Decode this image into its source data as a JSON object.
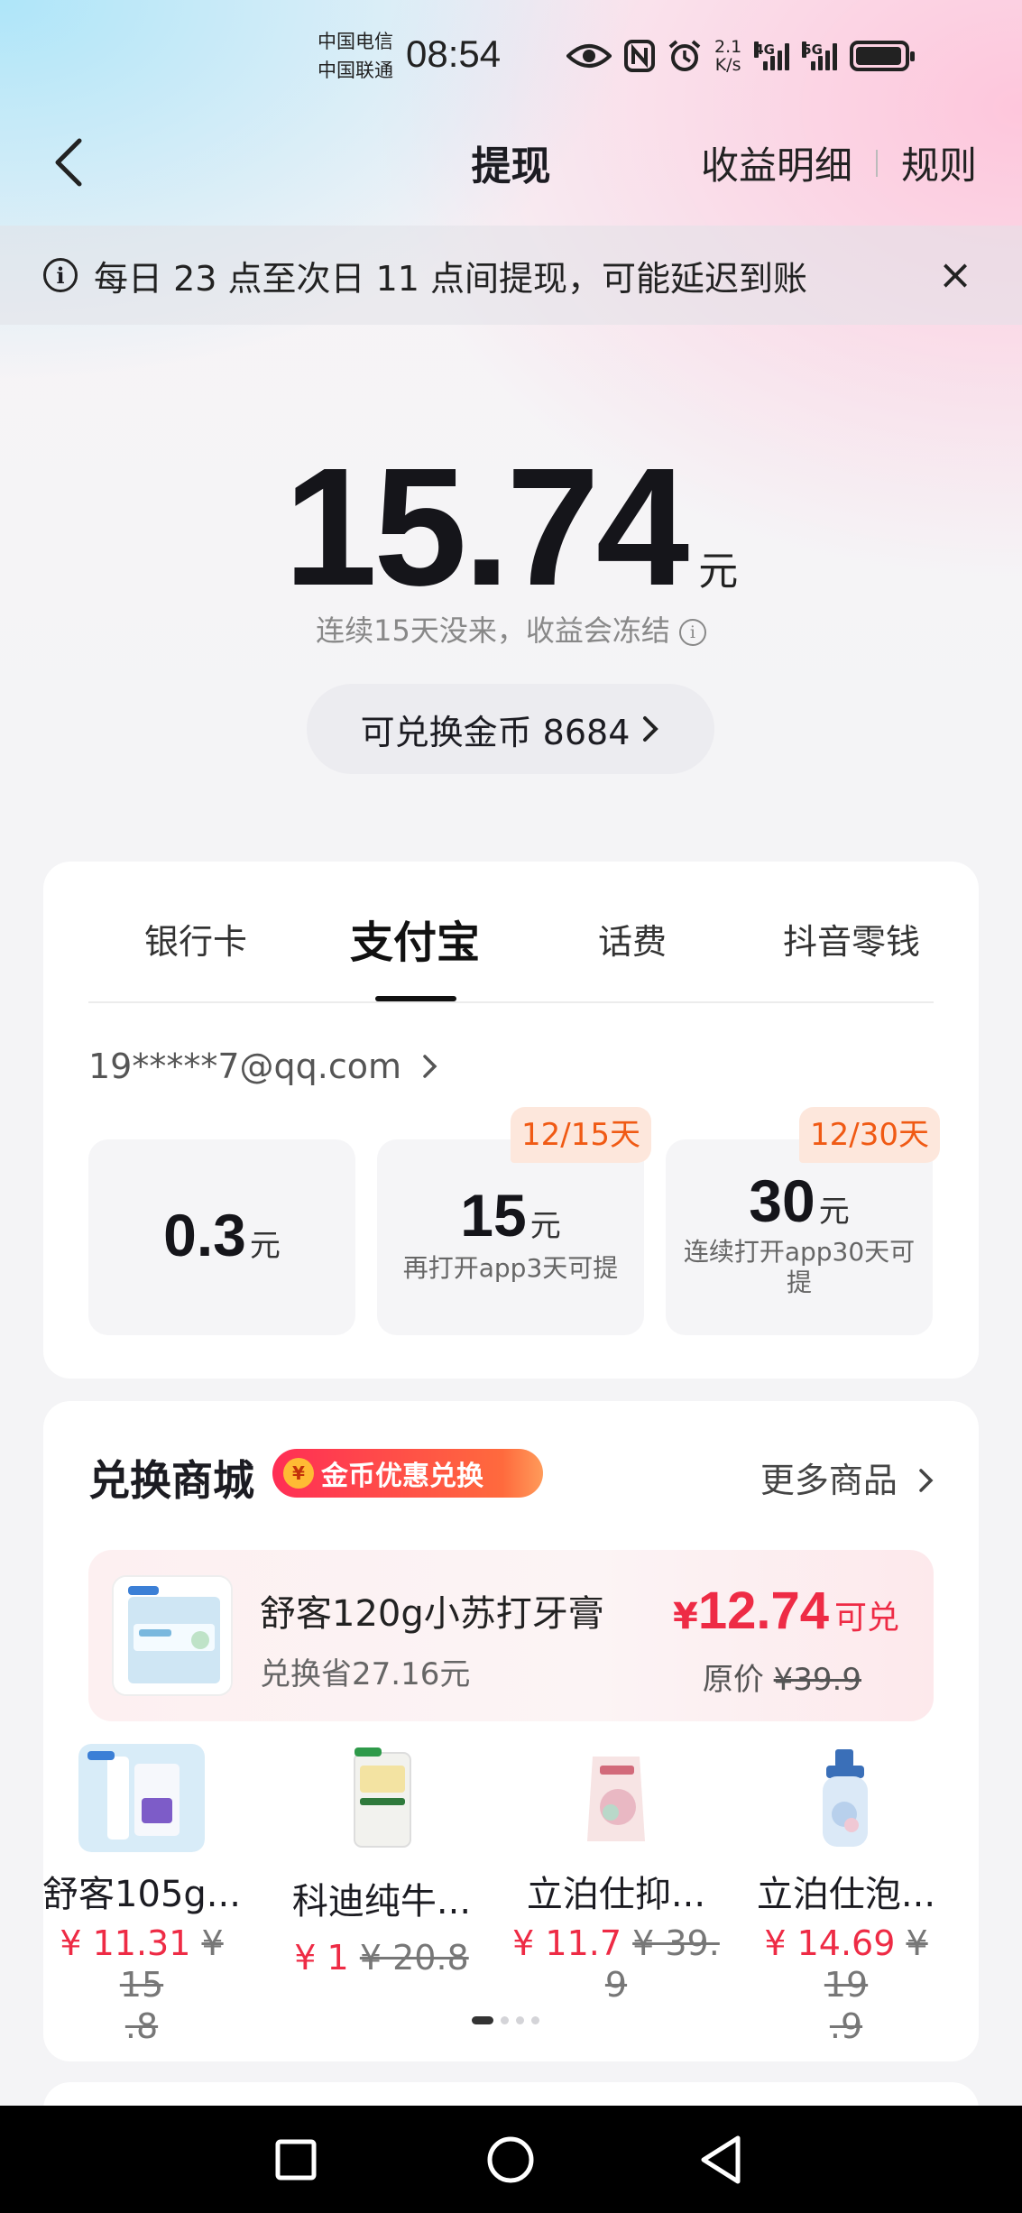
{
  "status_bar": {
    "carrier_1": "中国电信",
    "carrier_2": "中国联通",
    "time": "08:54",
    "net_speed_value": "2.1",
    "net_speed_unit": "K/s",
    "signal_1_label": "4G",
    "signal_2_label": "5G",
    "icons": [
      "eye-icon",
      "nfc-icon",
      "alarm-icon",
      "signal-icon",
      "battery-icon"
    ]
  },
  "nav": {
    "title": "提现",
    "earnings_detail": "收益明细",
    "rules": "规则"
  },
  "notice": {
    "text": "每日 23 点至次日 11 点间提现，可能延迟到账"
  },
  "balance": {
    "amount": "15.74",
    "unit": "元",
    "freeze_note": "连续15天没来，收益会冻结",
    "coins_label": "可兑换金币 8684"
  },
  "withdraw": {
    "tabs": [
      {
        "label": "银行卡"
      },
      {
        "label": "支付宝"
      },
      {
        "label": "话费"
      },
      {
        "label": "抖音零钱"
      }
    ],
    "active_tab": "支付宝",
    "account": "19*****7@qq.com",
    "options": [
      {
        "value": "0.3",
        "unit": "元",
        "note": "",
        "badge": ""
      },
      {
        "value": "15",
        "unit": "元",
        "note": "再打开app3天可提",
        "badge": "12/15天"
      },
      {
        "value": "30",
        "unit": "元",
        "note_line1": "连续打开app30天可",
        "note_line2": "提",
        "badge": "12/30天"
      }
    ]
  },
  "mall": {
    "title": "兑换商城",
    "badge": "金币优惠兑换",
    "badge_coin": "¥",
    "more": "更多商品",
    "featured": {
      "name": "舒客120g小苏打牙膏",
      "saving": "兑换省27.16元",
      "yen": "¥",
      "price": "12.74",
      "tag": "可兑",
      "orig_label": "原价",
      "orig_price": "¥39.9"
    },
    "products": [
      {
        "name": "舒客105g...",
        "now": "¥ 11.31",
        "was_line1": "¥ 15",
        "was_line2": ".8"
      },
      {
        "name": "科迪纯牛...",
        "now": "¥ 1",
        "was_line1": "¥ 20.8",
        "was_line2": ""
      },
      {
        "name": "立泊仕抑...",
        "now": "¥ 11.7",
        "was_line1": "¥ 39.",
        "was_line2": "9"
      },
      {
        "name": "立泊仕泡...",
        "now": "¥ 14.69",
        "was_line1": "¥ 19",
        "was_line2": ".9"
      }
    ]
  },
  "colors": {
    "accent_red": "#ee2b45",
    "badge_orange": "#f05a14",
    "badge_bg": "#fde7dc"
  }
}
